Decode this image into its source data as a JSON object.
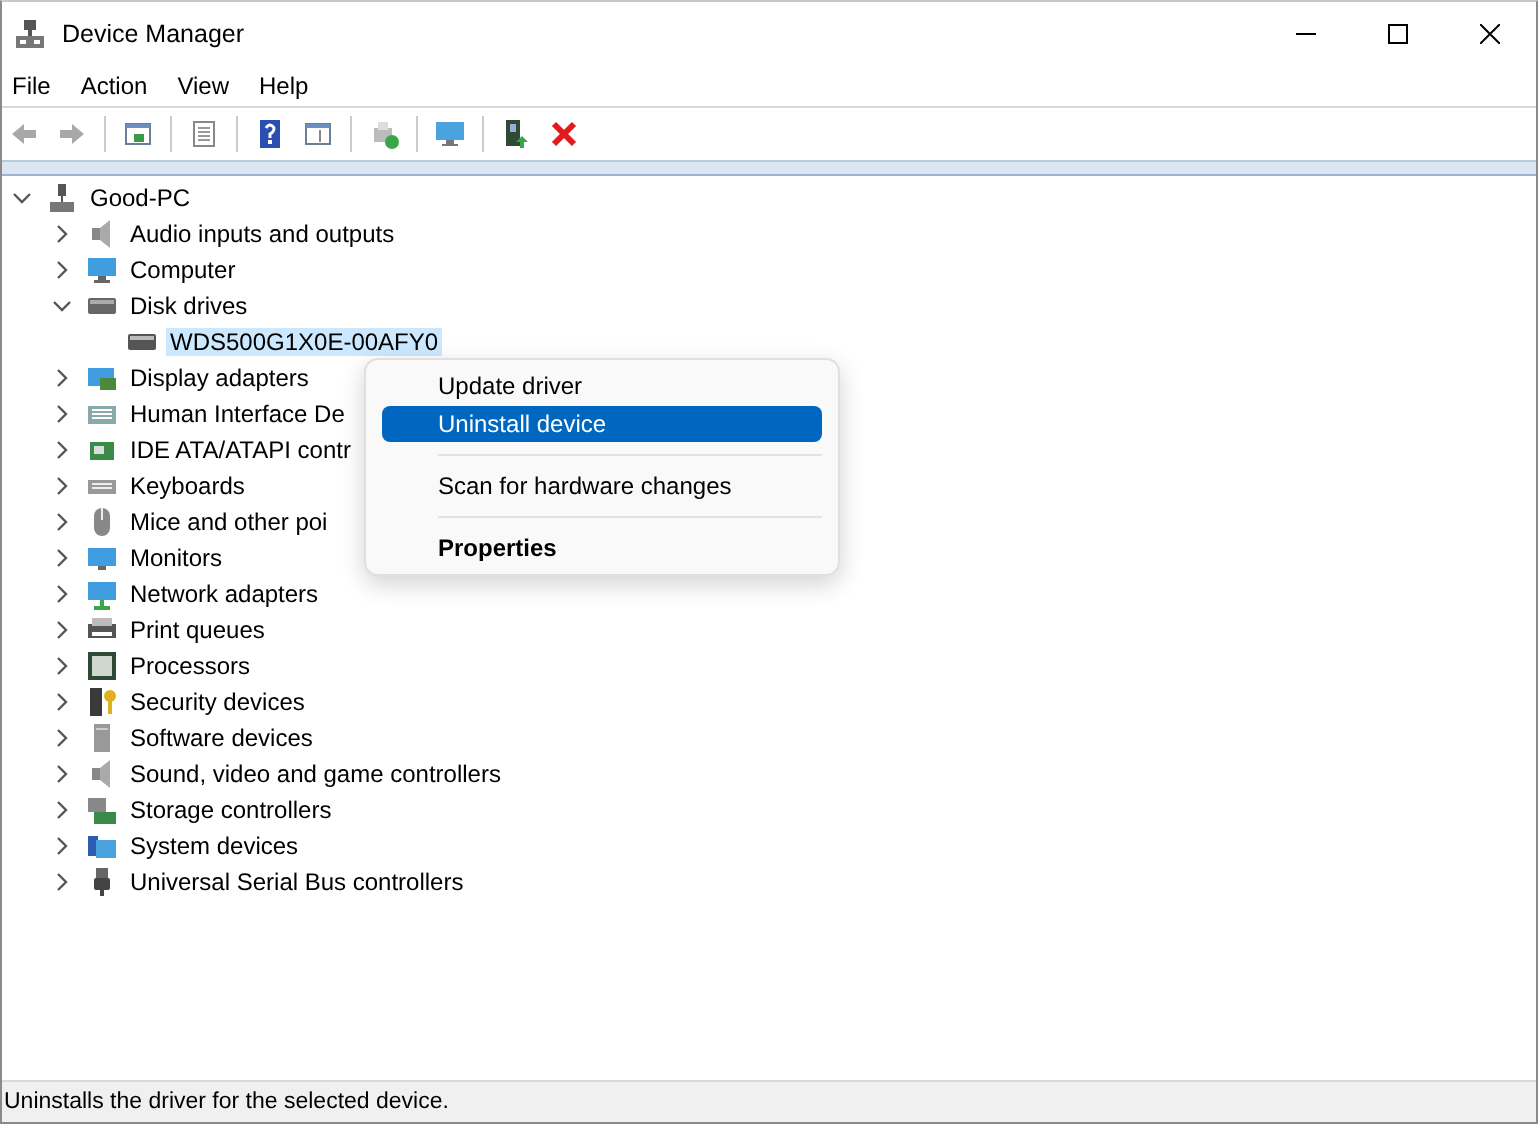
{
  "window": {
    "title": "Device Manager"
  },
  "menu_bar": [
    "File",
    "Action",
    "View",
    "Help"
  ],
  "tree": {
    "label": "Good-PC",
    "expanded": true,
    "selected": false,
    "children": [
      {
        "label": "Audio inputs and outputs",
        "expanded": false,
        "selected": false
      },
      {
        "label": "Computer",
        "expanded": false,
        "selected": false
      },
      {
        "label": "Disk drives",
        "expanded": true,
        "selected": false,
        "children": [
          {
            "label": "WDS500G1X0E-00AFY0",
            "selected": true
          }
        ]
      },
      {
        "label": "Display adapters",
        "expanded": false,
        "selected": false
      },
      {
        "label": "Human Interface De",
        "expanded": false,
        "selected": false
      },
      {
        "label": "IDE ATA/ATAPI contr",
        "expanded": false,
        "selected": false
      },
      {
        "label": "Keyboards",
        "expanded": false,
        "selected": false
      },
      {
        "label": "Mice and other poi",
        "expanded": false,
        "selected": false
      },
      {
        "label": "Monitors",
        "expanded": false,
        "selected": false
      },
      {
        "label": "Network adapters",
        "expanded": false,
        "selected": false
      },
      {
        "label": "Print queues",
        "expanded": false,
        "selected": false
      },
      {
        "label": "Processors",
        "expanded": false,
        "selected": false
      },
      {
        "label": "Security devices",
        "expanded": false,
        "selected": false
      },
      {
        "label": "Software devices",
        "expanded": false,
        "selected": false
      },
      {
        "label": "Sound, video and game controllers",
        "expanded": false,
        "selected": false
      },
      {
        "label": "Storage controllers",
        "expanded": false,
        "selected": false
      },
      {
        "label": "System devices",
        "expanded": false,
        "selected": false
      },
      {
        "label": "Universal Serial Bus controllers",
        "expanded": false,
        "selected": false
      }
    ]
  },
  "context_menu": [
    {
      "kind": "item",
      "label": "Update driver",
      "selected": false,
      "default": false
    },
    {
      "kind": "item",
      "label": "Uninstall device",
      "selected": true,
      "default": false
    },
    {
      "kind": "separator"
    },
    {
      "kind": "item",
      "label": "Scan for hardware changes",
      "selected": false,
      "default": false
    },
    {
      "kind": "separator"
    },
    {
      "kind": "item",
      "label": "Properties",
      "selected": false,
      "default": true
    }
  ],
  "status_bar": "Uninstalls the driver for the selected device."
}
